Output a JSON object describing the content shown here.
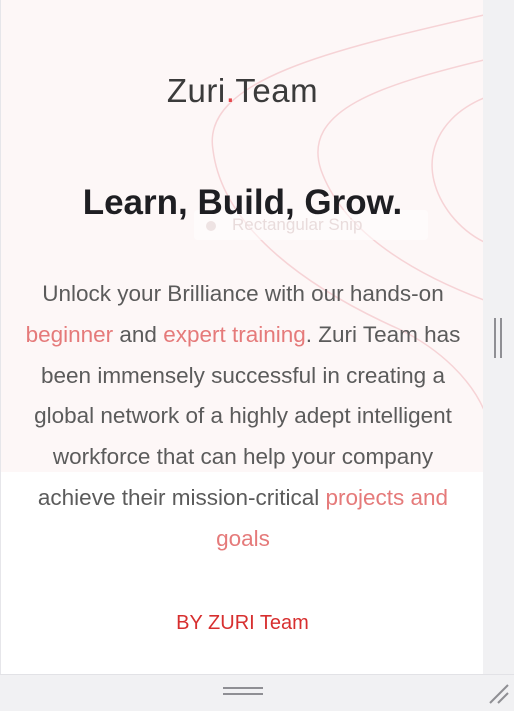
{
  "logo": {
    "part1": "Zuri",
    "dot": ".",
    "part2": "Team"
  },
  "hero": {
    "headline": "Learn, Build, Grow.",
    "description": {
      "t1": "Unlock your Brilliance with our hands-on ",
      "h1": "beginner",
      "t2": " and ",
      "h2": "expert training",
      "t3": ". Zuri Team has been immensely successful in creating a global network of a highly adept intelligent workforce that can help your company achieve their mission-critical ",
      "h3": "projects and goals"
    },
    "ghost_overlay": "Rectangular Snip"
  },
  "byline": "BY ZURI Team",
  "colors": {
    "accent": "#e5484d",
    "highlight": "#e57a7a",
    "byline": "#d72f2f",
    "hero_bg": "#fdf7f7",
    "headline": "#1e1e22",
    "body_text": "#5b5b5b"
  },
  "icons": {
    "scroll_grip": "vertical-grip-icon",
    "drag_handle": "horizontal-grip-icon",
    "resize_corner": "resize-corner-icon"
  }
}
